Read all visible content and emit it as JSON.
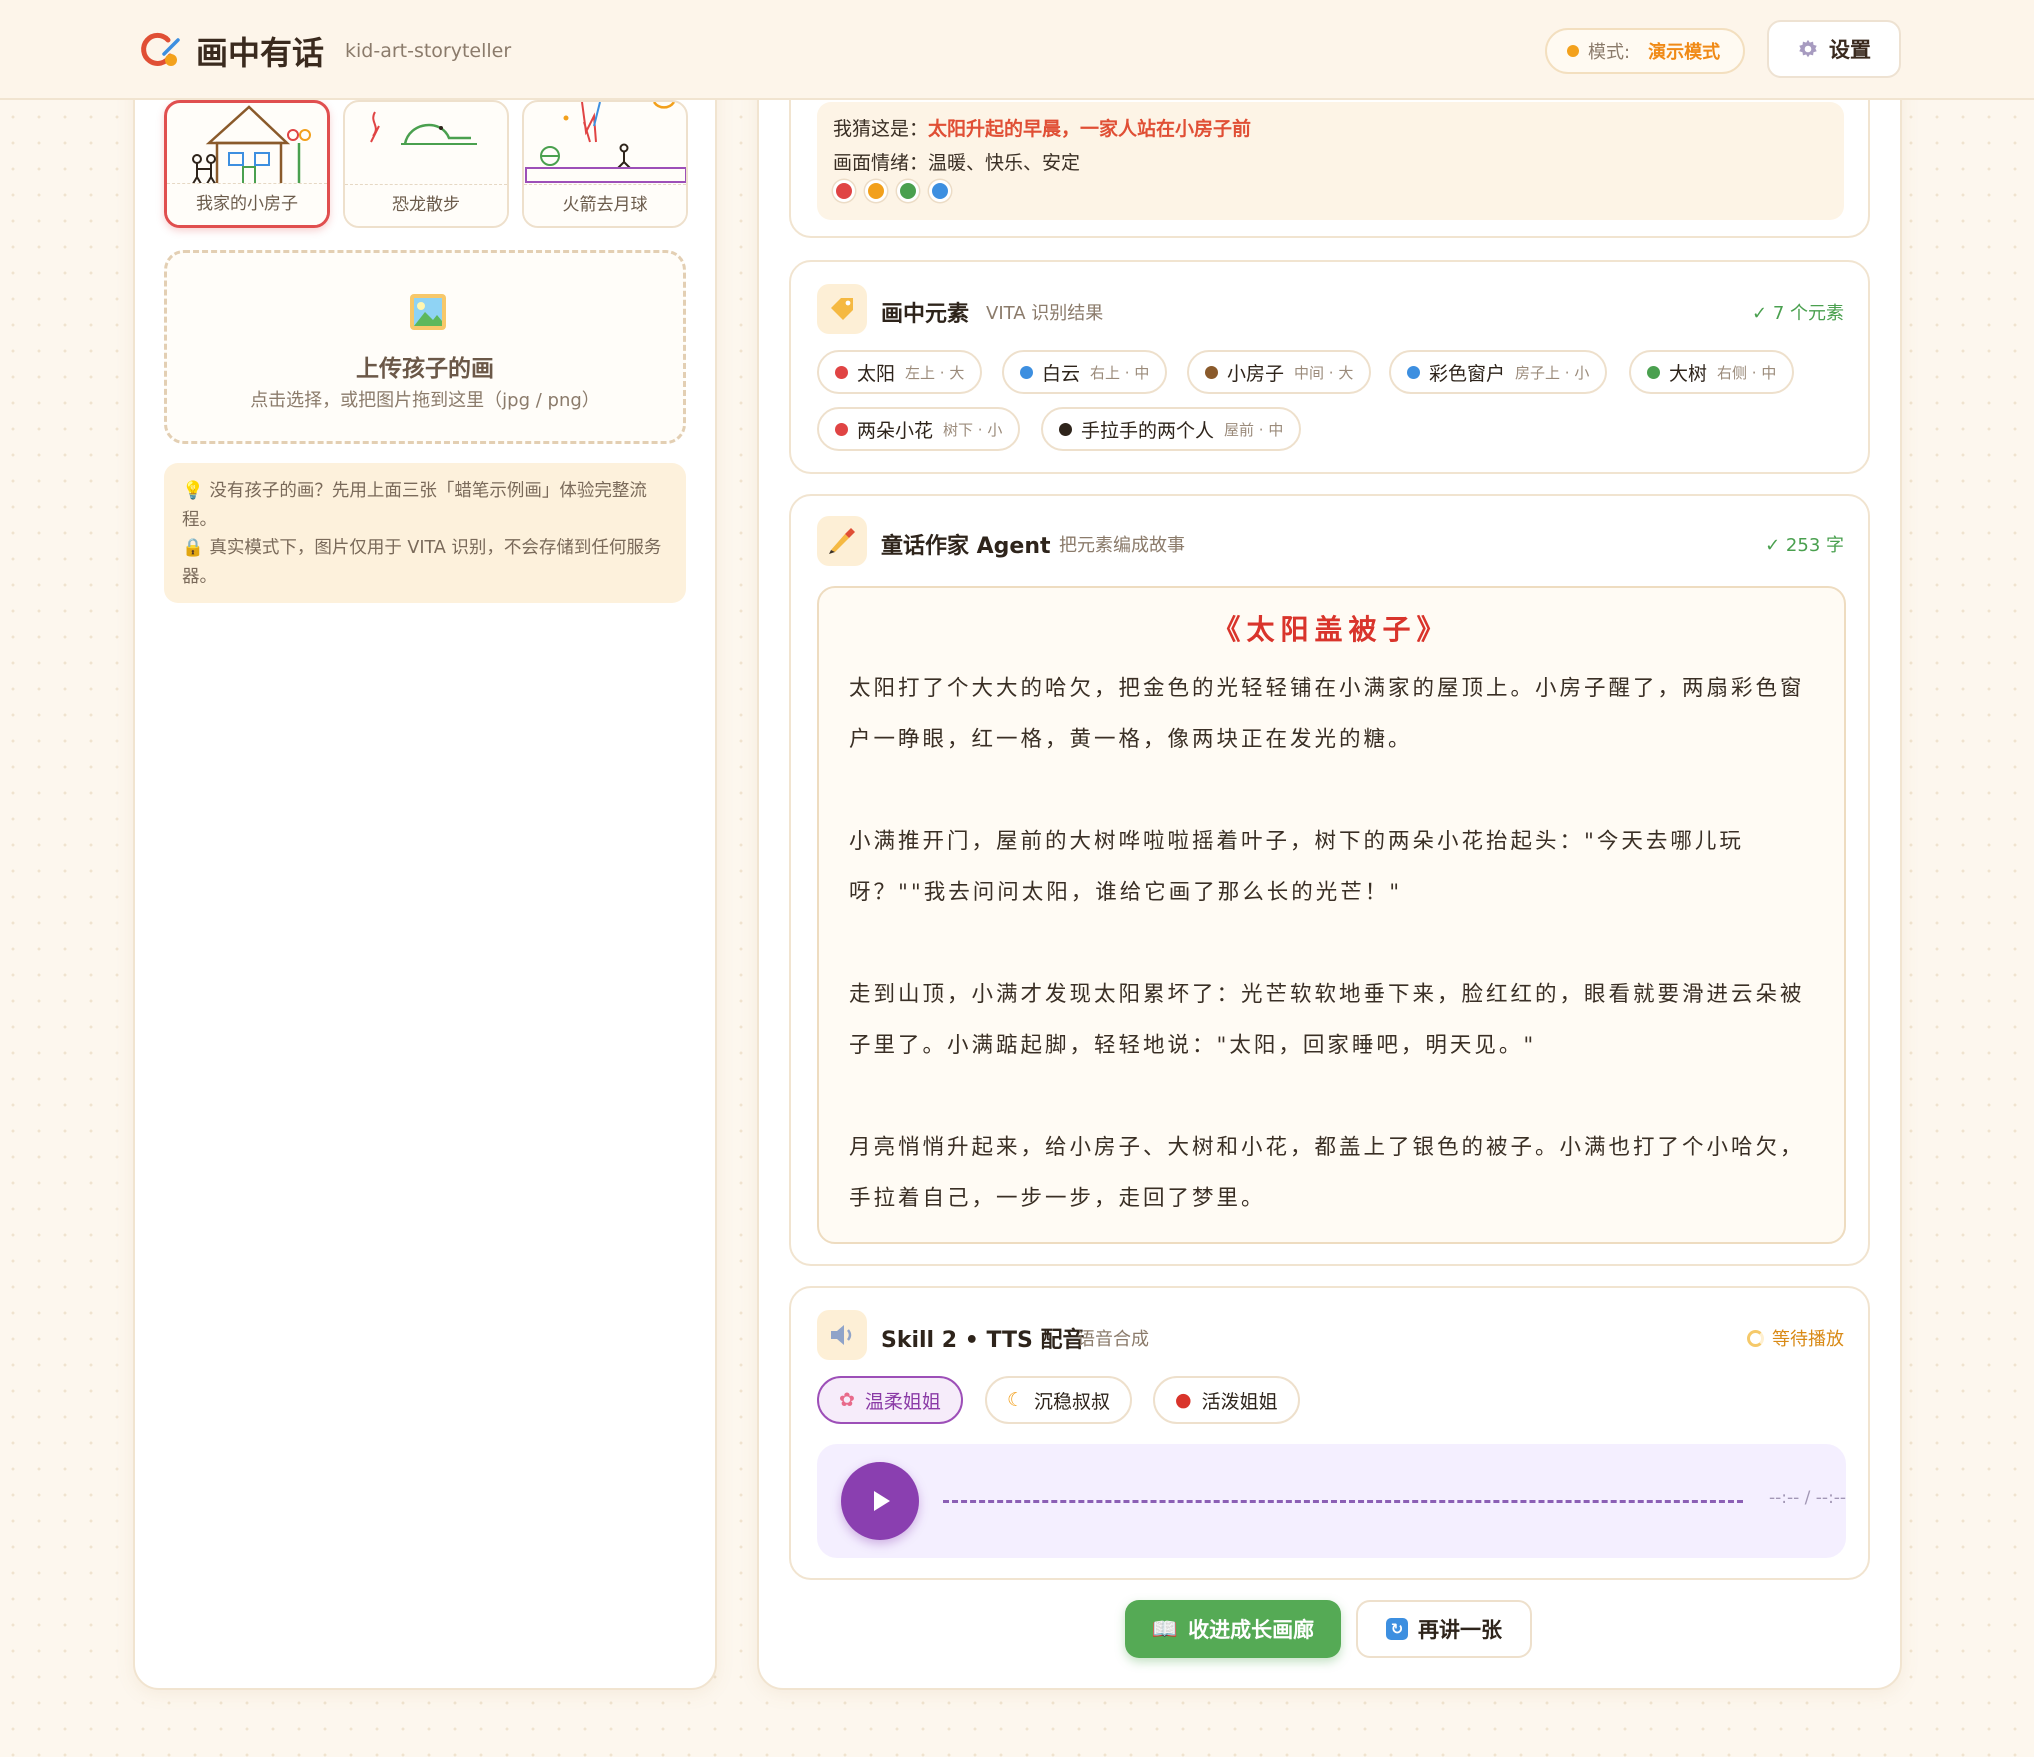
{
  "header": {
    "title": "画中有话",
    "subtitle": "kid-art-storyteller",
    "mode_label": "模式:",
    "mode_value": "演示模式",
    "settings_label": "设置"
  },
  "samples": [
    {
      "label": "我家的小房子",
      "selected": true
    },
    {
      "label": "恐龙散步",
      "selected": false
    },
    {
      "label": "火箭去月球",
      "selected": false
    }
  ],
  "upload": {
    "title": "上传孩子的画",
    "hint": "点击选择，或把图片拖到这里（jpg / png）"
  },
  "tips": {
    "line1": "没有孩子的画？先用上面三张「蜡笔示例画」体验完整流程。",
    "line2": "真实模式下，图片仅用于 VITA 识别，不会存储到任何服务器。"
  },
  "guess": {
    "prefix": "我猜这是：",
    "text": "太阳升起的早晨，一家人站在小房子前",
    "mood_prefix": "画面情绪：",
    "mood": "温暖、快乐、安定",
    "mood_colors": [
      "#e04444",
      "#f2a01c",
      "#4aa04f",
      "#3d8fe0"
    ]
  },
  "elements": {
    "title": "画中元素",
    "subtitle": "VITA 识别结果",
    "status": "✓ 7 个元素",
    "items": [
      {
        "name": "太阳",
        "pos": "左上 · 大",
        "color": "#e04444"
      },
      {
        "name": "白云",
        "pos": "右上 · 中",
        "color": "#3d8fe0"
      },
      {
        "name": "小房子",
        "pos": "中间 · 大",
        "color": "#8a5a2b"
      },
      {
        "name": "彩色窗户",
        "pos": "房子上 · 小",
        "color": "#3d8fe0"
      },
      {
        "name": "大树",
        "pos": "右侧 · 中",
        "color": "#4aa04f"
      },
      {
        "name": "两朵小花",
        "pos": "树下 · 小",
        "color": "#e04444"
      },
      {
        "name": "手拉手的两个人",
        "pos": "屋前 · 中",
        "color": "#2e241b"
      }
    ]
  },
  "story": {
    "title": "童话作家 Agent",
    "subtitle": "把元素编成故事",
    "status": "✓ 253 字",
    "story_title": "《太阳盖被子》",
    "paragraphs": [
      "太阳打了个大大的哈欠，把金色的光轻轻铺在小满家的屋顶上。小房子醒了，两扇彩色窗户一睁眼，红一格，黄一格，像两块正在发光的糖。",
      "小满推开门，屋前的大树哗啦啦摇着叶子，树下的两朵小花抬起头：\"今天去哪儿玩呀？\"\"我去问问太阳，谁给它画了那么长的光芒！\"",
      "走到山顶，小满才发现太阳累坏了：光芒软软地垂下来，脸红红的，眼看就要滑进云朵被子里了。小满踮起脚，轻轻地说：\"太阳，回家睡吧，明天见。\"",
      "月亮悄悄升起来，给小房子、大树和小花，都盖上了银色的被子。小满也打了个小哈欠，手拉着自己，一步一步，走回了梦里。"
    ]
  },
  "tts": {
    "title": "Skill 2 • TTS 配音",
    "subtitle": "语音合成",
    "status": "等待播放",
    "voices": [
      {
        "label": "温柔姐姐",
        "selected": true
      },
      {
        "label": "沉稳叔叔",
        "selected": false
      },
      {
        "label": "活泼姐姐",
        "selected": false
      }
    ],
    "time": "--:-- / --:--"
  },
  "actions": {
    "collect_label": "收进成长画廊",
    "again_label": "再讲一张"
  },
  "colors": {
    "accent": "#f08a16",
    "story_title": "#d9342b",
    "purple": "#8a3fb0",
    "green": "#55aa55"
  }
}
